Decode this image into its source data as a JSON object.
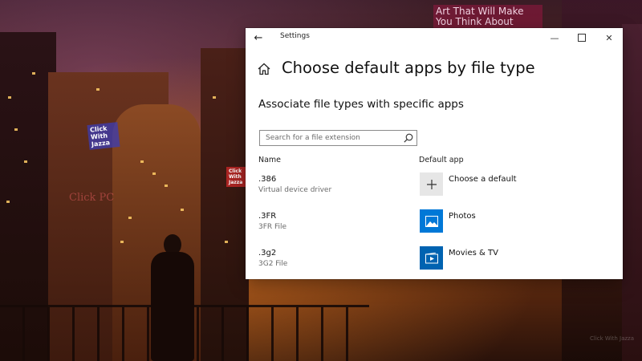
{
  "background": {
    "signs": [
      "Click With Jazza",
      "Art That Will Make You Think About",
      "Click PC",
      "Click With Jazza"
    ],
    "watermark": "Click With Jazza"
  },
  "window": {
    "app_title": "Settings",
    "controls": {
      "minimize": "—",
      "maximize": "",
      "close": "✕"
    },
    "back_glyph": "←"
  },
  "page": {
    "title": "Choose default apps by file type",
    "section_title": "Associate file types with specific apps"
  },
  "search": {
    "placeholder": "Search for a file extension",
    "value": ""
  },
  "table": {
    "headers": {
      "name": "Name",
      "default_app": "Default app"
    },
    "rows": [
      {
        "extension": ".386",
        "description": "Virtual device driver",
        "app": "Choose a default",
        "app_icon": "plus-icon"
      },
      {
        "extension": ".3FR",
        "description": "3FR File",
        "app": "Photos",
        "app_icon": "photos-icon"
      },
      {
        "extension": ".3g2",
        "description": "3G2 File",
        "app": "Movies & TV",
        "app_icon": "movies-tv-icon"
      }
    ]
  },
  "colors": {
    "accent": "#0078d7",
    "photos_tile": "#0078d7",
    "movies_tile": "#0063b1",
    "plus_tile": "#e6e6e6"
  }
}
